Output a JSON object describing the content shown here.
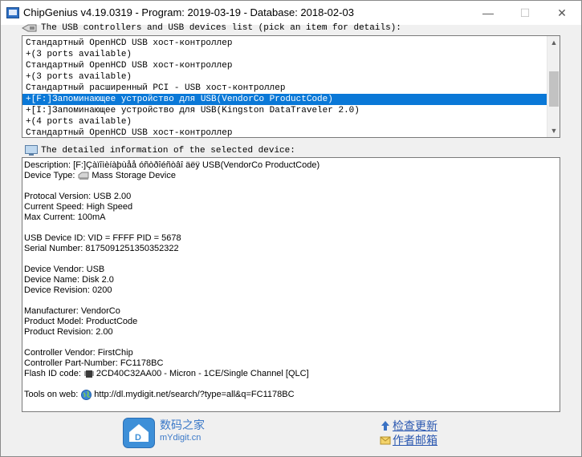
{
  "window": {
    "title": "ChipGenius v4.19.0319 - Program: 2019-03-19 - Database: 2018-02-03",
    "buttons": {
      "minimize": "—",
      "maximize": "☐",
      "close": "✕"
    }
  },
  "device_list": {
    "header": "The USB controllers and USB devices list (pick an item for details):",
    "items": [
      "Стандартный OpenHCD USB хост-контроллер",
      "+(3 ports available)",
      "Стандартный OpenHCD USB хост-контроллер",
      "+(3 ports available)",
      "Стандартный расширенный PCI - USB хост-контроллер",
      "+[F:]Запоминающее устройство для USB(VendorCo ProductCode)",
      "+[I:]Запоминающее устройство для USB(Kingston DataTraveler 2.0)",
      "+(4 ports available)",
      "Стандартный OpenHCD USB хост-контроллер"
    ],
    "selected_index": 5
  },
  "details": {
    "header": "The detailed information of the selected device:",
    "description": "Description: [F:]Çàïîìèíàþùåå óñòðîéñòâî äëÿ USB(VendorCo ProductCode)",
    "device_type_label": "Device Type:",
    "device_type_value": "Mass Storage Device",
    "protocal_version": "Protocal Version: USB 2.00",
    "current_speed": "Current Speed: High Speed",
    "max_current": "Max Current: 100mA",
    "usb_device_id": "USB Device ID: VID = FFFF PID = 5678",
    "serial_number": "Serial Number: 8175091251350352322",
    "device_vendor": "Device Vendor: USB",
    "device_name": "Device Name: Disk 2.0",
    "device_revision": "Device Revision: 0200",
    "manufacturer": "Manufacturer: VendorCo",
    "product_model": "Product Model: ProductCode",
    "product_revision": "Product Revision: 2.00",
    "controller_vendor": "Controller Vendor: FirstChip",
    "controller_part": "Controller Part-Number: FC1178BC",
    "flash_id_label": "Flash ID code:",
    "flash_id_value": "2CD40C32AA00 - Micron - 1CE/Single Channel [QLC]",
    "tools_label": "Tools on web:",
    "tools_url": "http://dl.mydigit.net/search/?type=all&q=FC1178BC"
  },
  "footer": {
    "logo_letter": "D",
    "site_name_cn": "数码之家",
    "site_name_en": "mYdigit.cn",
    "check_update": "检查更新",
    "author_email": "作者邮箱"
  }
}
